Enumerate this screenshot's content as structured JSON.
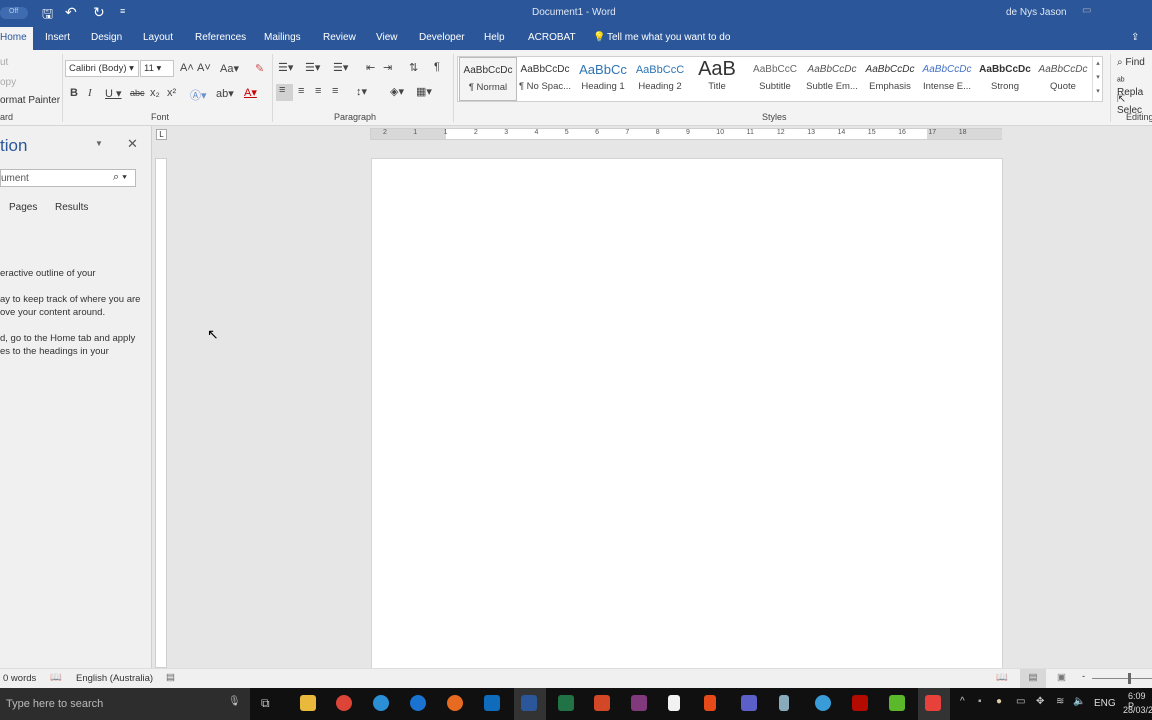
{
  "titlebar": {
    "autosave": "Off",
    "title": "Document1 - Word",
    "user": "de Nys Jason"
  },
  "tabs": [
    "Home",
    "Insert",
    "Design",
    "Layout",
    "References",
    "Mailings",
    "Review",
    "View",
    "Developer",
    "Help",
    "ACROBAT"
  ],
  "tell_me": "Tell me what you want to do",
  "clipboard": {
    "cut": "ut",
    "copy": "opy",
    "format_painter": "ormat Painter",
    "label": "ard"
  },
  "font": {
    "name": "Calibri (Body)",
    "size": "11",
    "label": "Font"
  },
  "paragraph": {
    "label": "Paragraph"
  },
  "styles": {
    "label": "Styles",
    "items": [
      {
        "preview": "AaBbCcDc",
        "name": "¶ Normal"
      },
      {
        "preview": "AaBbCcDc",
        "name": "¶ No Spac..."
      },
      {
        "preview": "AaBbCc",
        "name": "Heading 1"
      },
      {
        "preview": "AaBbCcC",
        "name": "Heading 2"
      },
      {
        "preview": "AaB",
        "name": "Title"
      },
      {
        "preview": "AaBbCcC",
        "name": "Subtitle"
      },
      {
        "preview": "AaBbCcDc",
        "name": "Subtle Em..."
      },
      {
        "preview": "AaBbCcDc",
        "name": "Emphasis"
      },
      {
        "preview": "AaBbCcDc",
        "name": "Intense E..."
      },
      {
        "preview": "AaBbCcDc",
        "name": "Strong"
      },
      {
        "preview": "AaBbCcDc",
        "name": "Quote"
      }
    ]
  },
  "editing": {
    "find": "Find",
    "replace": "Repla",
    "select": "Selec",
    "label": "Editing"
  },
  "nav": {
    "title": "tion",
    "search_placeholder": "ument",
    "tabs": [
      "Pages",
      "Results"
    ],
    "lines": [
      "eractive outline of your",
      "",
      "ay to keep track of where you are",
      "ove your content around.",
      "",
      "d, go to the Home tab and apply",
      "es to the headings in your"
    ]
  },
  "ruler": [
    "2",
    "1",
    "1",
    "2",
    "3",
    "4",
    "5",
    "6",
    "7",
    "8",
    "9",
    "10",
    "11",
    "12",
    "13",
    "14",
    "15",
    "16",
    "17",
    "18"
  ],
  "status": {
    "words": "0 words",
    "language": "English (Australia)"
  },
  "taskbar": {
    "search": "Type here to search",
    "lang": "ENG",
    "time": "6:09 P",
    "date": "28/03/2"
  }
}
